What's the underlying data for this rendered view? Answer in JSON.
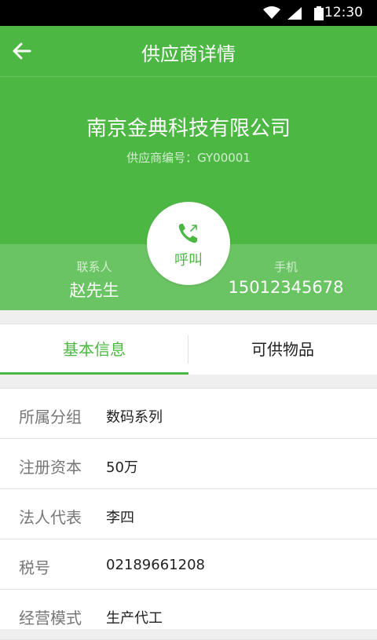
{
  "status_bar": {
    "time": "12:30"
  },
  "app_bar": {
    "title": "供应商详情"
  },
  "supplier": {
    "company_name": "南京金典科技有限公司",
    "code_text": "供应商编号：GY00001"
  },
  "contact": {
    "person_label": "联系人",
    "person_value": "赵先生",
    "phone_label": "手机",
    "phone_value": "15012345678",
    "call_label": "呼叫"
  },
  "tabs": [
    {
      "label": "基本信息",
      "active": true
    },
    {
      "label": "可供物品",
      "active": false
    }
  ],
  "info": [
    {
      "key": "所属分组",
      "value": "数码系列"
    },
    {
      "key": "注册资本",
      "value": "50万"
    },
    {
      "key": "法人代表",
      "value": "李四"
    },
    {
      "key": "税号",
      "value": "02189661208"
    },
    {
      "key": "经营模式",
      "value": "生产代工"
    }
  ],
  "colors": {
    "primary": "#4cb843",
    "strip": "#6ac463"
  },
  "icons": [
    "wifi-icon",
    "signal-icon",
    "battery-icon",
    "back-arrow-icon",
    "phone-call-icon"
  ]
}
